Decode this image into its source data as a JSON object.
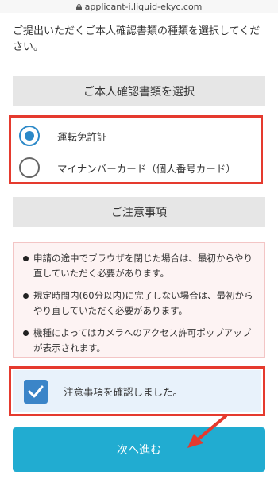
{
  "browser": {
    "url": "applicant-i.liquid-ekyc.com",
    "lock_icon": "lock-icon"
  },
  "intro": {
    "text": "ご提出いただくご本人確認書類の種類を選択してください。"
  },
  "document_section": {
    "heading": "ご本人確認書類を選択",
    "options": [
      {
        "label": "運転免許証",
        "selected": true
      },
      {
        "label": "マイナンバーカード（個人番号カード）",
        "selected": false
      }
    ]
  },
  "notice_section": {
    "heading": "ご注意事項",
    "items": [
      "申請の途中でブラウザを閉じた場合は、最初からやり直していただく必要があります。",
      "規定時間内(60分以内)に完了しない場合は、最初からやり直していただく必要があります。",
      "機種によってはカメラへのアクセス許可ポップアップが表示されます。"
    ]
  },
  "confirm": {
    "label": "注意事項を確認しました。",
    "checked": true
  },
  "next_button": {
    "label": "次へ進む"
  },
  "colors": {
    "accent": "#2c89c8",
    "button": "#21acd1",
    "highlight": "#e53a2e",
    "notice_bg": "#fdf3f3"
  }
}
